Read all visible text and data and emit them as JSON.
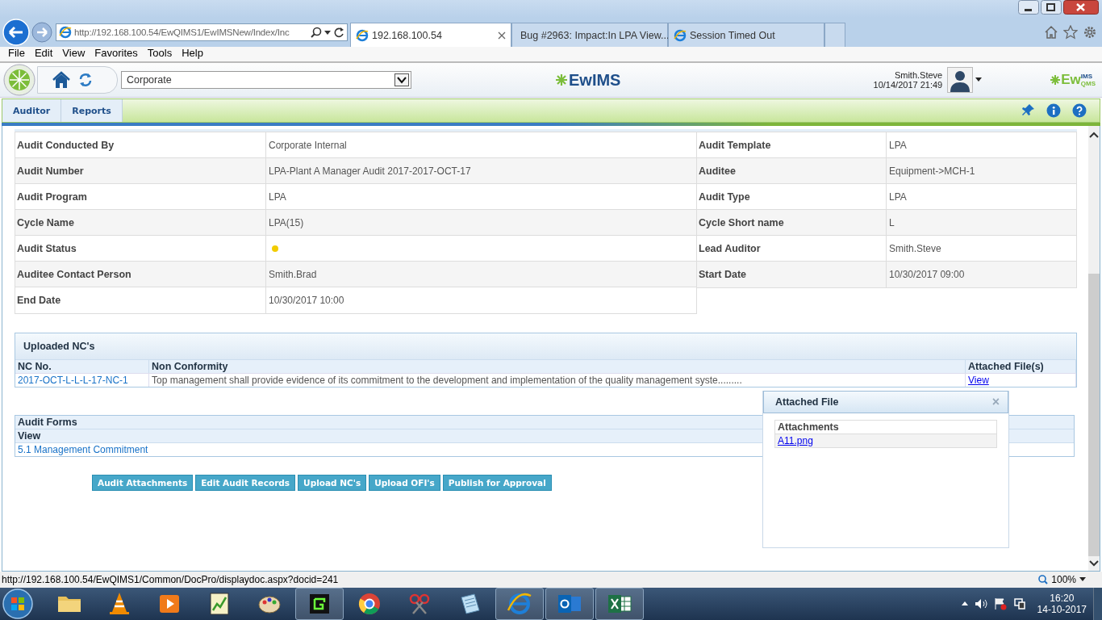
{
  "browser": {
    "address": "http://192.168.100.54/EwQIMS1/EwIMSNew/Index/Inc",
    "tabs": [
      {
        "label": "192.168.100.54",
        "selected": true
      },
      {
        "label": "Bug #2963: Impact:In LPA View...",
        "selected": false
      },
      {
        "label": "Session Timed Out",
        "selected": false
      }
    ],
    "menu": [
      "File",
      "Edit",
      "View",
      "Favorites",
      "Tools",
      "Help"
    ]
  },
  "header": {
    "location": "Corporate",
    "logo": "EwIMS",
    "user": "Smith.Steve",
    "datetime": "10/14/2017 21:49",
    "brand": {
      "main": "Ew",
      "top": "IMS",
      "bottom": "QMS"
    }
  },
  "nav": [
    "Auditor",
    "Reports"
  ],
  "details_left": [
    {
      "label": "Audit Conducted By",
      "value": "Corporate Internal"
    },
    {
      "label": "Audit Number",
      "value": "LPA-Plant A Manager Audit 2017-2017-OCT-17"
    },
    {
      "label": "Audit Program",
      "value": "LPA"
    },
    {
      "label": "Cycle Name",
      "value": "LPA(15)"
    },
    {
      "label": "Audit Status",
      "kind": "dot",
      "color": "#f2cc00"
    },
    {
      "label": "Auditee Contact Person",
      "value": "Smith.Brad"
    },
    {
      "label": "End Date",
      "value": "10/30/2017 10:00"
    }
  ],
  "details_right": [
    {
      "label": "Audit Template",
      "value": "LPA"
    },
    {
      "label": "Auditee",
      "value": "Equipment->MCH-1"
    },
    {
      "label": "Audit Type",
      "value": "LPA"
    },
    {
      "label": "Cycle Short name",
      "value": "L"
    },
    {
      "label": "Lead Auditor",
      "value": "Smith.Steve"
    },
    {
      "label": "Start Date",
      "value": "10/30/2017 09:00"
    }
  ],
  "uploaded_ncs": {
    "title": "Uploaded NC's",
    "columns": [
      "NC No.",
      "Non Conformity",
      "Attached File(s)"
    ],
    "rows": [
      {
        "nc_no": "2017-OCT-L-L-L-17-NC-1",
        "text": "Top management shall provide evidence of its commitment to the development and implementation of the quality management syste.........",
        "file": "View"
      }
    ]
  },
  "audit_forms": {
    "title": "Audit Forms",
    "column": "View",
    "rows": [
      "5.1 Management Commitment"
    ]
  },
  "buttons": [
    "Audit Attachments",
    "Edit Audit Records",
    "Upload NC's",
    "Upload OFI's",
    "Publish for Approval"
  ],
  "popup": {
    "title": "Attached File",
    "close": "×",
    "column": "Attachments",
    "files": [
      "A11.png"
    ]
  },
  "status_bar": {
    "url": "http://192.168.100.54/EwQIMS1/Common/DocPro/displaydoc.aspx?docid=241",
    "zoom": "100%"
  },
  "taskbar": {
    "apps": [
      {
        "kind": "folder",
        "active": false
      },
      {
        "kind": "cone",
        "active": false
      },
      {
        "kind": "player",
        "active": false
      },
      {
        "kind": "chart",
        "active": false
      },
      {
        "kind": "paint",
        "active": false
      },
      {
        "kind": "terminal",
        "active": true
      },
      {
        "kind": "chrome",
        "active": false
      },
      {
        "kind": "scissors",
        "active": false
      },
      {
        "kind": "notepad",
        "active": false
      },
      {
        "kind": "ie",
        "active": true
      },
      {
        "kind": "outlook",
        "active": true
      },
      {
        "kind": "excel",
        "active": true
      }
    ],
    "time": "16:20",
    "date": "14-10-2017"
  }
}
